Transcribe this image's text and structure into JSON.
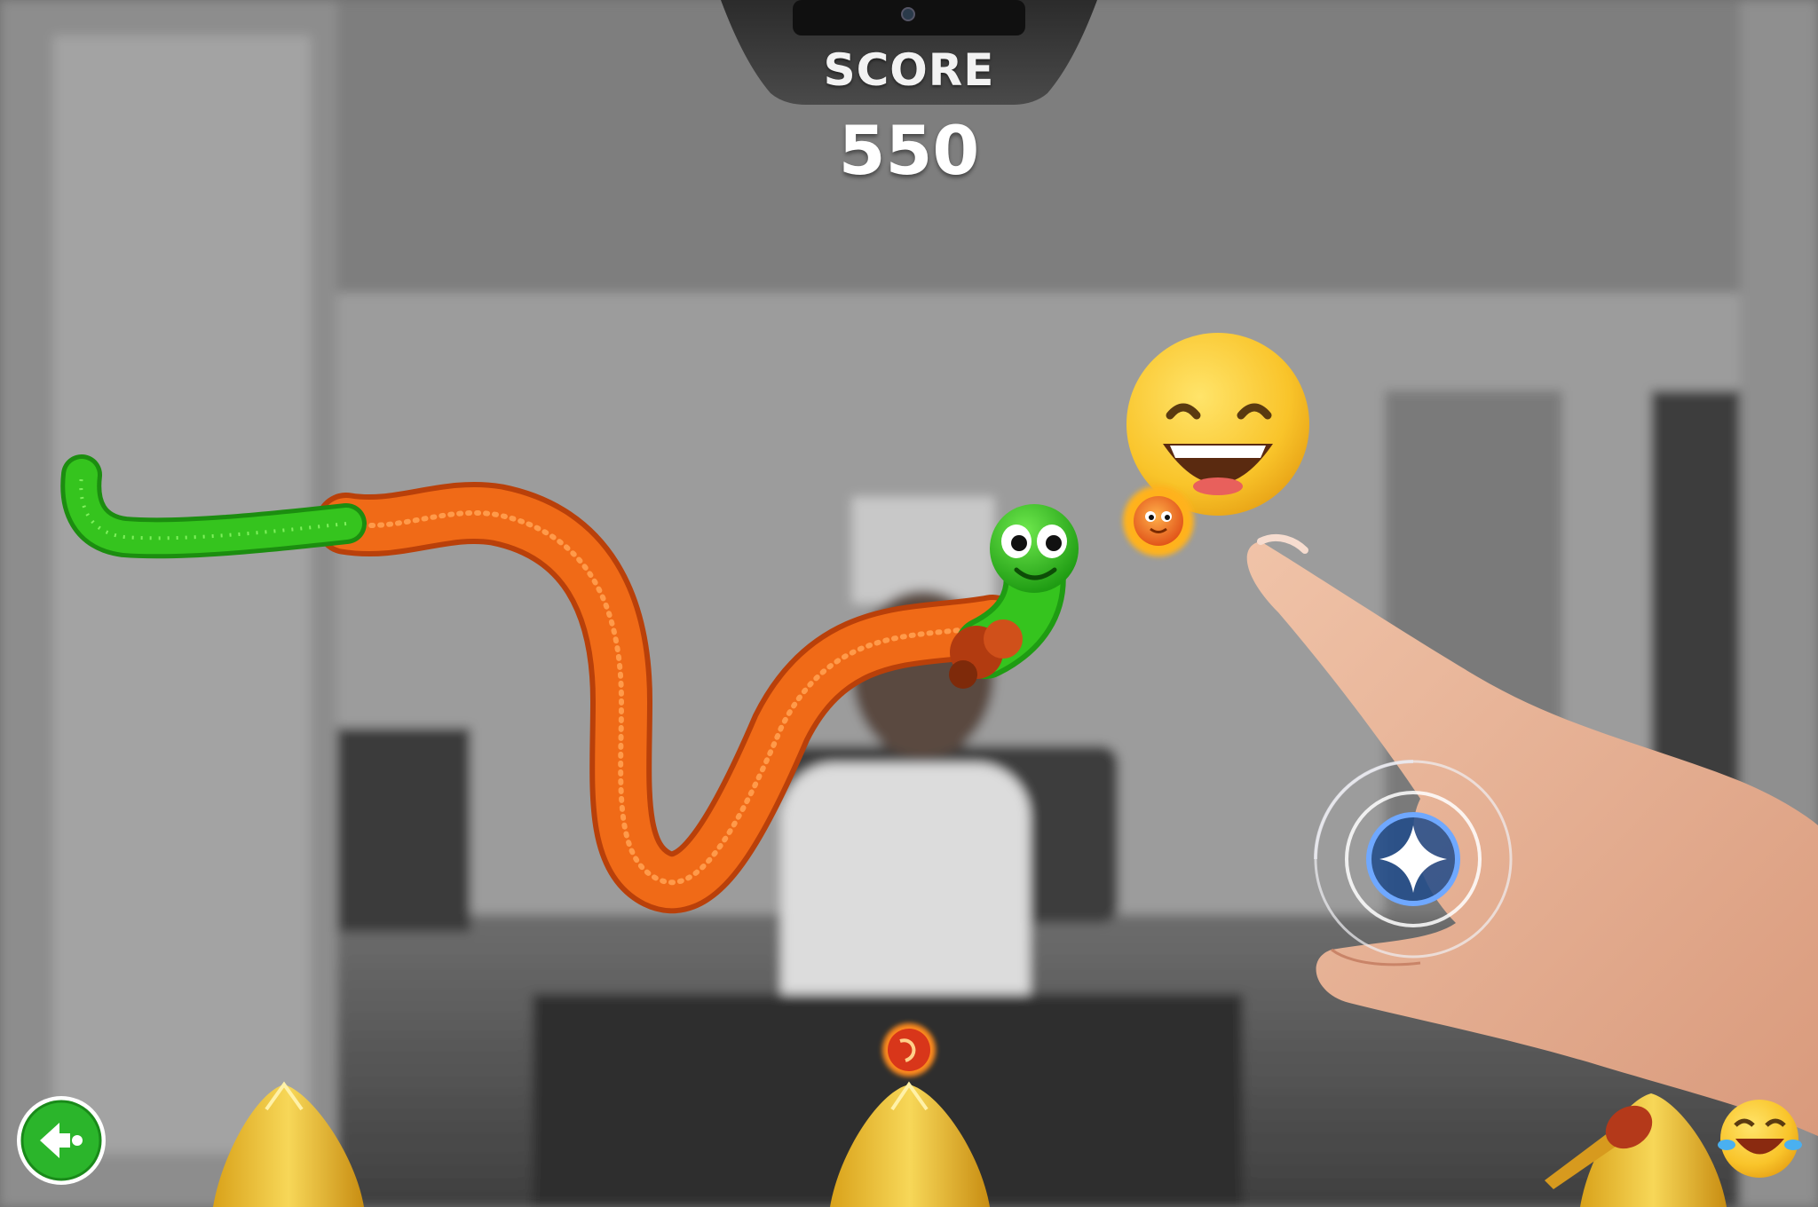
{
  "hud": {
    "score_label": "SCORE",
    "score_value": "550"
  },
  "controls": {
    "back_icon": "back-arrow-icon",
    "target_icon": "sparkle-icon"
  },
  "colors": {
    "worm_green": "#35c41e",
    "worm_orange": "#f06a17",
    "back_button_green": "#2bb52b"
  }
}
